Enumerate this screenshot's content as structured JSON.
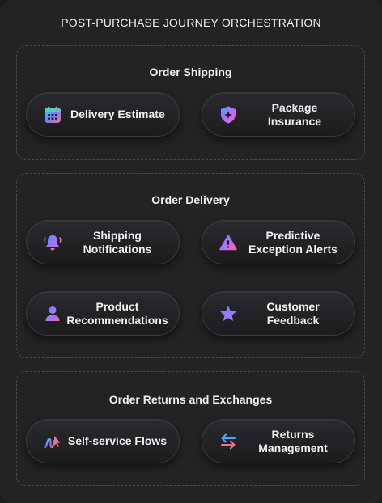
{
  "title": "POST-PURCHASE JOURNEY ORCHESTRATION",
  "sections": [
    {
      "title": "Order Shipping",
      "items": [
        {
          "label": "Delivery Estimate",
          "icon": "calendar-icon"
        },
        {
          "label": "Package Insurance",
          "icon": "shield-icon"
        }
      ]
    },
    {
      "title": "Order Delivery",
      "items": [
        {
          "label": "Shipping Notifications",
          "icon": "bell-icon"
        },
        {
          "label": "Predictive Exception Alerts",
          "icon": "warning-icon"
        },
        {
          "label": "Product Recommendations",
          "icon": "user-icon"
        },
        {
          "label": "Customer Feedback",
          "icon": "star-icon"
        }
      ]
    },
    {
      "title": "Order Returns and Exchanges",
      "items": [
        {
          "label": "Self-service Flows",
          "icon": "self-service-icon"
        },
        {
          "label": "Returns Management",
          "icon": "swap-arrows-icon"
        }
      ]
    }
  ],
  "colors": {
    "background": "#232326",
    "gradient_start": "#5b8cff",
    "gradient_mid": "#b36cff",
    "gradient_end": "#ff6b8a"
  }
}
